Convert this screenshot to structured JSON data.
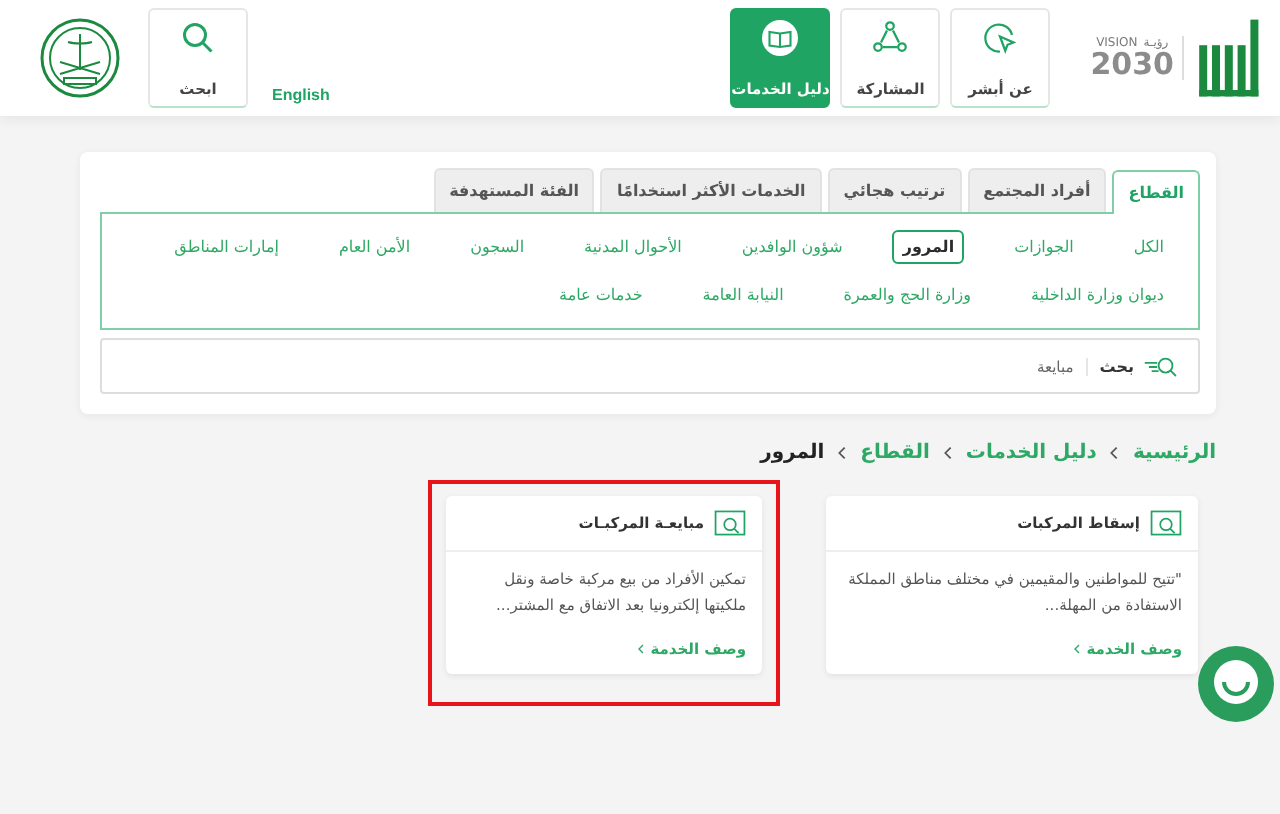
{
  "header": {
    "vision": {
      "word": "VISION",
      "arabic": "رؤيـة",
      "year": "2030"
    },
    "nav_tiles": [
      {
        "kind": "about",
        "label": "عن أبشر",
        "selected": false
      },
      {
        "kind": "share",
        "label": "المشاركة",
        "selected": false
      },
      {
        "kind": "book",
        "label": "دليل الخدمات",
        "selected": true
      }
    ],
    "language": "English",
    "search_tile": "ابحث"
  },
  "tabs": [
    {
      "label": "القطاع",
      "selected": true
    },
    {
      "label": "أفراد المجتمع",
      "selected": false
    },
    {
      "label": "ترتيب هجائي",
      "selected": false
    },
    {
      "label": "الخدمات الأكثر استخدامًا",
      "selected": false
    },
    {
      "label": "الفئة المستهدفة",
      "selected": false
    }
  ],
  "filters": [
    {
      "label": "الكل",
      "selected": false
    },
    {
      "label": "الجوازات",
      "selected": false
    },
    {
      "label": "المرور",
      "selected": true
    },
    {
      "label": "شؤون الوافدين",
      "selected": false
    },
    {
      "label": "الأحوال المدنية",
      "selected": false
    },
    {
      "label": "السجون",
      "selected": false
    },
    {
      "label": "الأمن العام",
      "selected": false
    },
    {
      "label": "إمارات المناطق",
      "selected": false
    },
    {
      "label": "ديوان وزارة الداخلية",
      "selected": false
    },
    {
      "label": "وزارة الحج والعمرة",
      "selected": false
    },
    {
      "label": "النيابة العامة",
      "selected": false
    },
    {
      "label": "خدمات عامة",
      "selected": false
    }
  ],
  "search": {
    "label": "بحث",
    "value": "مبايعة"
  },
  "breadcrumb": [
    {
      "label": "الرئيسية",
      "current": false
    },
    {
      "label": "دليل الخدمات",
      "current": false
    },
    {
      "label": "القطاع",
      "current": false
    },
    {
      "label": "المرور",
      "current": true
    }
  ],
  "cards": [
    {
      "title": "إسقاط المركبات",
      "description": "\"تتيح للمواطنين والمقيمين في مختلف مناطق المملكة الاستفادة من المهلة...",
      "link": "وصف الخدمة",
      "highlighted": false
    },
    {
      "title": "مبايعـة المركبـات",
      "description": "تمكين الأفراد من بيع مركبة خاصة ونقل ملكيتها إلكترونيا بعد الاتفاق مع المشتر...",
      "link": "وصف الخدمة",
      "highlighted": true
    }
  ]
}
